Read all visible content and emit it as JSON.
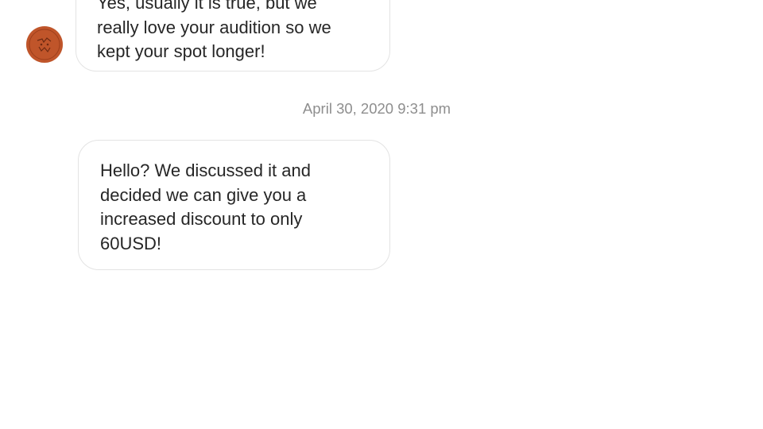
{
  "messages": [
    {
      "sender": "other",
      "lines": [
        "Yes, usually it is true, but we",
        "really love your audition so we",
        "kept your spot longer!"
      ],
      "avatar_icon": "profile-avatar"
    },
    {
      "sender": "other",
      "timestamp": "April 30, 2020 9:31 pm",
      "lines": [
        "Hello? We discussed it and",
        "decided we can give you a",
        "increased discount to only",
        "60USD!"
      ]
    }
  ],
  "colors": {
    "avatar": "#c0552a",
    "bubble_border": "#e3e3e3",
    "text": "#262626",
    "timestamp": "#8e8e8e",
    "background": "#ffffff"
  }
}
